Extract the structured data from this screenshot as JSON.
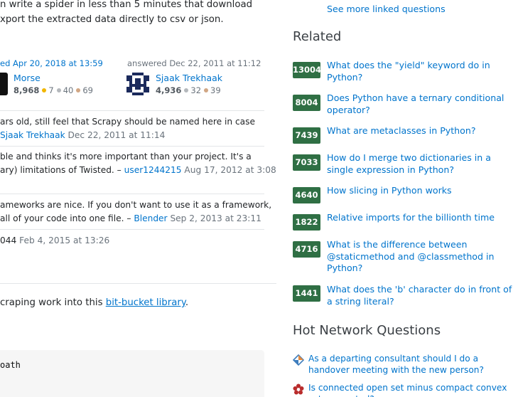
{
  "answer": {
    "line1": "n write a spider in less than 5 minutes that download",
    "line2": "xport the extracted data directly to csv or json."
  },
  "signatures": {
    "left": {
      "label": "ed Apr 20, 2018 at 13:59",
      "name": "Morse",
      "rep": "8,968",
      "gold": "7",
      "silver": "40",
      "bronze": "69"
    },
    "right": {
      "label": "answered Dec 22, 2011 at 11:12",
      "name": "Sjaak Trekhaak",
      "rep": "4,936",
      "silver": "32",
      "bronze": "39"
    }
  },
  "comments": [
    {
      "line1": "ars old, still feel that Scrapy should be named here in case",
      "user": "Sjaak Trekhaak",
      "time": "Dec 22, 2011 at 11:14"
    },
    {
      "line1": "ble and thinks it's more important than your project. It's a",
      "line2": "ary) limitations of Twisted. –",
      "user": "user1244215",
      "time": "Aug 17, 2012 at 3:08"
    },
    {
      "line1": "ameworks are nice. If you don't want to use it as a framework,",
      "line2": "all of your code into one file. –",
      "user": "Blender",
      "time": "Sep 2, 2013 at 23:11"
    },
    {
      "user_tail": "044",
      "time": "Feb 4, 2015 at 13:26"
    }
  ],
  "answer2": {
    "prefix": "craping work into this ",
    "link": "bit-bucket library",
    "suffix": "."
  },
  "code": {
    "line1": "oath"
  },
  "sidebar": {
    "see_more": "See more linked questions",
    "related_title": "Related",
    "related": [
      {
        "score": "13004",
        "title": "What does the \"yield\" keyword do in Python?"
      },
      {
        "score": "8004",
        "title": "Does Python have a ternary conditional operator?"
      },
      {
        "score": "7439",
        "title": "What are metaclasses in Python?"
      },
      {
        "score": "7033",
        "title": "How do I merge two dictionaries in a single expression in Python?"
      },
      {
        "score": "4640",
        "title": "How slicing in Python works"
      },
      {
        "score": "1822",
        "title": "Relative imports for the billionth time"
      },
      {
        "score": "4716",
        "title": "What is the difference between @staticmethod and @classmethod in Python?"
      },
      {
        "score": "1441",
        "title": "What does the 'b' character do in front of a string literal?"
      }
    ],
    "hnq_title": "Hot Network Questions",
    "hnq": [
      {
        "icon": "workplace-icon",
        "title": "As a departing consultant should I do a handover meeting with the new person?"
      },
      {
        "icon": "math-icon",
        "title": "Is connected open set minus compact convex set connected?"
      }
    ]
  },
  "colors": {
    "link": "#0074cc",
    "badge": "#2f6f44",
    "text": "#232629",
    "muted": "#6a737c"
  }
}
